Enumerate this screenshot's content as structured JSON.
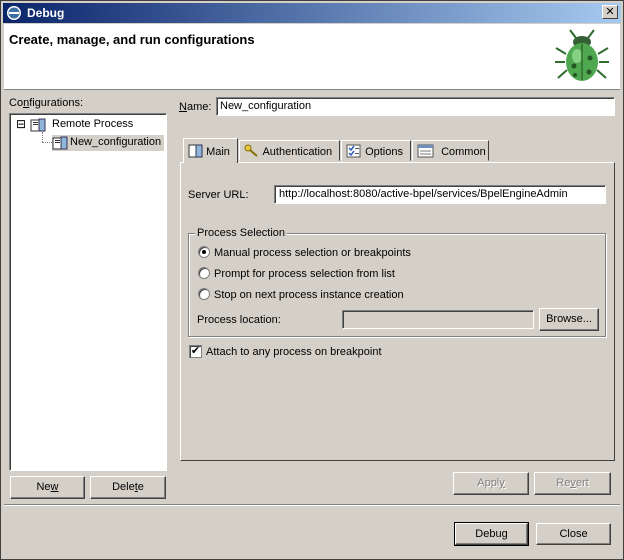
{
  "window": {
    "title": "Debug",
    "close_glyph": "✕"
  },
  "header": {
    "title": "Create, manage, and run configurations",
    "icon": "bug-icon"
  },
  "configurations": {
    "label_pre": "Co",
    "label_u": "n",
    "label_post": "figurations:",
    "tree": [
      {
        "label": "Remote Process",
        "expander": "⊟",
        "icon": "remote-process-icon"
      },
      {
        "label": "New_configuration",
        "icon": "config-icon",
        "selected": true
      }
    ],
    "new_pre": "Ne",
    "new_u": "w",
    "delete_pre": "Dele",
    "delete_u": "t",
    "delete_post": "e"
  },
  "name_field": {
    "label_u": "N",
    "label_post": "ame:",
    "value": "New_configuration"
  },
  "tabs": [
    {
      "label": "Main",
      "icon": "main-tab-icon",
      "active": true
    },
    {
      "label": "Authentication",
      "icon": "key-icon"
    },
    {
      "label": "Options",
      "icon": "options-icon"
    },
    {
      "label": "Common",
      "icon": "common-icon"
    }
  ],
  "main": {
    "server_url_label": "Server URL:",
    "server_url_value": "http://localhost:8080/active-bpel/services/BpelEngineAdmin",
    "process_selection": {
      "title": "Process Selection",
      "options": [
        {
          "label": "Manual process selection or breakpoints",
          "selected": true
        },
        {
          "label": "Prompt for process selection from list",
          "selected": false
        },
        {
          "label": "Stop on next process instance creation",
          "selected": false
        }
      ],
      "location_label": "Process location:",
      "location_value": "",
      "browse_label": "Browse..."
    },
    "attach_label": "Attach to any process on breakpoint",
    "attach_checked": true
  },
  "buttons": {
    "apply_pre": "Appl",
    "apply_u": "y",
    "revert_pre": "Re",
    "revert_u": "v",
    "revert_post": "ert",
    "debug_label": "Debug",
    "close_label": "Close"
  },
  "colors": {
    "title_bar": "#0a246a",
    "face": "#d4d0c8",
    "selection": "#d4d0c8"
  }
}
